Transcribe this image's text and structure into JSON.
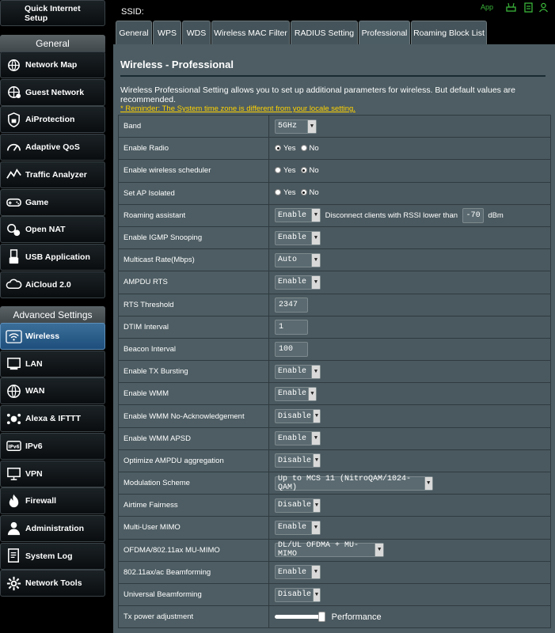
{
  "topbar": {
    "ssid_label": "SSID:",
    "app_label": "App",
    "accent_green": "#3ab53a",
    "icons": [
      "router-icon",
      "usb-icon",
      "user-icon"
    ]
  },
  "sidebar": {
    "quick_setup": "Quick Internet Setup",
    "general_heading": "General",
    "general_items": [
      {
        "label": "Network Map",
        "icon": "network-map-icon"
      },
      {
        "label": "Guest Network",
        "icon": "guest-network-icon"
      },
      {
        "label": "AiProtection",
        "icon": "shield-lock-icon"
      },
      {
        "label": "Adaptive QoS",
        "icon": "gauge-icon"
      },
      {
        "label": "Traffic Analyzer",
        "icon": "traffic-chart-icon"
      },
      {
        "label": "Game",
        "icon": "gamepad-icon"
      },
      {
        "label": "Open NAT",
        "icon": "open-nat-icon"
      },
      {
        "label": "USB Application",
        "icon": "usb-icon"
      },
      {
        "label": "AiCloud 2.0",
        "icon": "cloud-icon"
      }
    ],
    "advanced_heading": "Advanced Settings",
    "advanced_items": [
      {
        "label": "Wireless",
        "icon": "wifi-icon",
        "active": true
      },
      {
        "label": "LAN",
        "icon": "lan-icon"
      },
      {
        "label": "WAN",
        "icon": "globe-icon"
      },
      {
        "label": "Alexa & IFTTT",
        "icon": "alexa-icon"
      },
      {
        "label": "IPv6",
        "icon": "ipv6-icon"
      },
      {
        "label": "VPN",
        "icon": "vpn-icon"
      },
      {
        "label": "Firewall",
        "icon": "firewall-icon"
      },
      {
        "label": "Administration",
        "icon": "admin-user-icon"
      },
      {
        "label": "System Log",
        "icon": "system-log-icon"
      },
      {
        "label": "Network Tools",
        "icon": "gear-icon"
      }
    ]
  },
  "tabs": [
    {
      "label": "General"
    },
    {
      "label": "WPS"
    },
    {
      "label": "WDS"
    },
    {
      "label": "Wireless MAC Filter"
    },
    {
      "label": "RADIUS Setting"
    },
    {
      "label": "Professional",
      "selected": true
    },
    {
      "label": "Roaming Block List"
    }
  ],
  "panel": {
    "title": "Wireless - Professional",
    "description": "Wireless Professional Setting allows you to set up additional parameters for wireless. But default values are recommended.",
    "reminder": "* Reminder: The System time zone is different from your locale setting.",
    "reminder_color": "#ffd200"
  },
  "settings": {
    "band": {
      "label": "Band",
      "value": "5GHz"
    },
    "enable_radio": {
      "label": "Enable Radio",
      "yes": "Yes",
      "no": "No",
      "selected": "Yes"
    },
    "wireless_scheduler": {
      "label": "Enable wireless scheduler",
      "yes": "Yes",
      "no": "No",
      "selected": "No"
    },
    "ap_isolated": {
      "label": "Set AP Isolated",
      "yes": "Yes",
      "no": "No",
      "selected": "No"
    },
    "roaming_assistant": {
      "label": "Roaming assistant",
      "value": "Enable",
      "text_before": "Disconnect clients with RSSI lower than",
      "rssi": "-70",
      "unit": "dBm"
    },
    "igmp_snooping": {
      "label": "Enable IGMP Snooping",
      "value": "Enable"
    },
    "multicast_rate": {
      "label": "Multicast Rate(Mbps)",
      "value": "Auto"
    },
    "ampdu_rts": {
      "label": "AMPDU RTS",
      "value": "Enable"
    },
    "rts_threshold": {
      "label": "RTS Threshold",
      "value": "2347"
    },
    "dtim_interval": {
      "label": "DTIM Interval",
      "value": "1"
    },
    "beacon_interval": {
      "label": "Beacon Interval",
      "value": "100"
    },
    "tx_bursting": {
      "label": "Enable TX Bursting",
      "value": "Enable"
    },
    "wmm": {
      "label": "Enable WMM",
      "value": "Enable"
    },
    "wmm_no_ack": {
      "label": "Enable WMM No-Acknowledgement",
      "value": "Disable"
    },
    "wmm_apsd": {
      "label": "Enable WMM APSD",
      "value": "Enable"
    },
    "ampdu_aggregation": {
      "label": "Optimize AMPDU aggregation",
      "value": "Disable"
    },
    "modulation": {
      "label": "Modulation Scheme",
      "value": "Up to MCS 11 (NitroQAM/1024-QAM)"
    },
    "airtime_fairness": {
      "label": "Airtime Fairness",
      "value": "Disable"
    },
    "mu_mimo": {
      "label": "Multi-User MIMO",
      "value": "Enable"
    },
    "ofdma": {
      "label": "OFDMA/802.11ax MU-MIMO",
      "value": "DL/UL OFDMA + MU-MIMO"
    },
    "beamforming": {
      "label": "802.11ax/ac Beamforming",
      "value": "Enable"
    },
    "universal_beamforming": {
      "label": "Universal Beamforming",
      "value": "Disable"
    },
    "tx_power": {
      "label": "Tx power adjustment",
      "value_label": "Performance",
      "level": 1.0
    }
  }
}
